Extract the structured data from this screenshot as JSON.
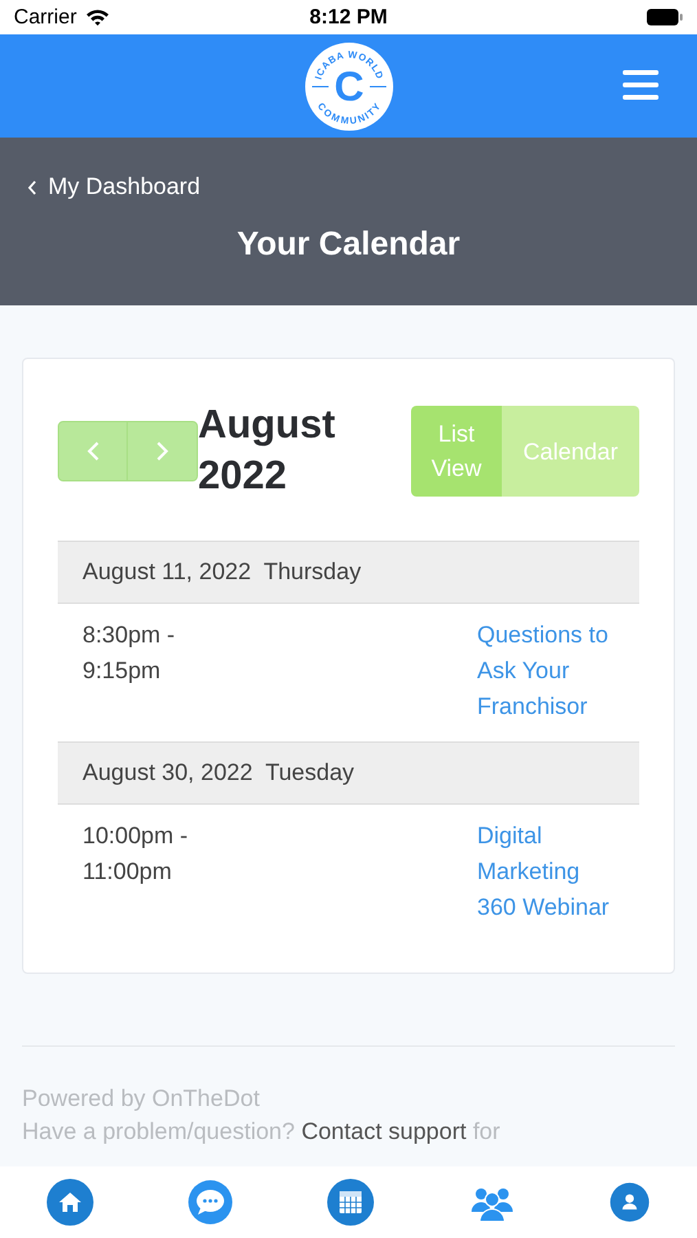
{
  "status_bar": {
    "carrier": "Carrier",
    "time": "8:12 PM"
  },
  "header": {
    "logo": {
      "top_text": "ICABA WORLD",
      "letter": "C",
      "bottom_text": "COMMUNITY"
    }
  },
  "page_header": {
    "back_link": "My Dashboard",
    "title": "Your Calendar"
  },
  "calendar": {
    "month_line_1": "August",
    "month_line_2": "2022",
    "view_toggle": [
      {
        "label": "List View",
        "selected": true
      },
      {
        "label": "Calendar",
        "selected": false
      }
    ],
    "days": [
      {
        "date": "August 11, 2022  Thursday",
        "events": [
          {
            "time": "8:30pm - 9:15pm",
            "title": "Questions to Ask Your Franchisor"
          }
        ]
      },
      {
        "date": "August 30, 2022  Tuesday",
        "events": [
          {
            "time": "10:00pm - 11:00pm",
            "title": "Digital Marketing 360 Webinar"
          }
        ]
      }
    ]
  },
  "footer": {
    "powered_by": "Powered by OnTheDot",
    "help_prefix": "Have a problem/question?",
    "help_link": "Contact support",
    "help_suffix": "for"
  }
}
